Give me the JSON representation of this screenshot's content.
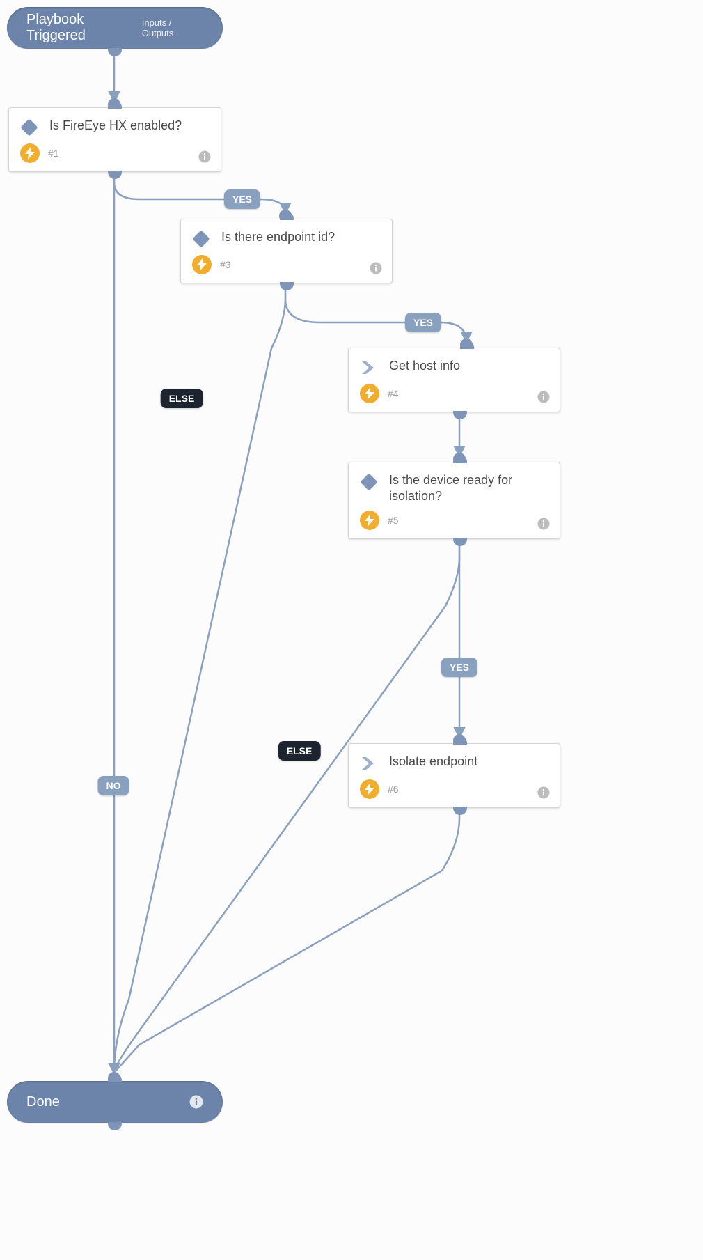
{
  "colors": {
    "node_fill": "#6c84aa",
    "edge": "#8aa0bf",
    "else_tag": "#1c2430",
    "bolt": "#f0ad2e"
  },
  "labels": {
    "yes": "YES",
    "no": "NO",
    "else": "ELSE"
  },
  "start": {
    "title": "Playbook Triggered",
    "io_label": "Inputs / Outputs"
  },
  "end": {
    "title": "Done"
  },
  "steps": {
    "s1": {
      "id": "#1",
      "title": "Is FireEye HX enabled?",
      "kind": "condition"
    },
    "s3": {
      "id": "#3",
      "title": "Is there endpoint id?",
      "kind": "condition"
    },
    "s4": {
      "id": "#4",
      "title": "Get host info",
      "kind": "action"
    },
    "s5": {
      "id": "#5",
      "title": "Is the device ready for isolation?",
      "kind": "condition"
    },
    "s6": {
      "id": "#6",
      "title": "Isolate endpoint",
      "kind": "action"
    }
  }
}
